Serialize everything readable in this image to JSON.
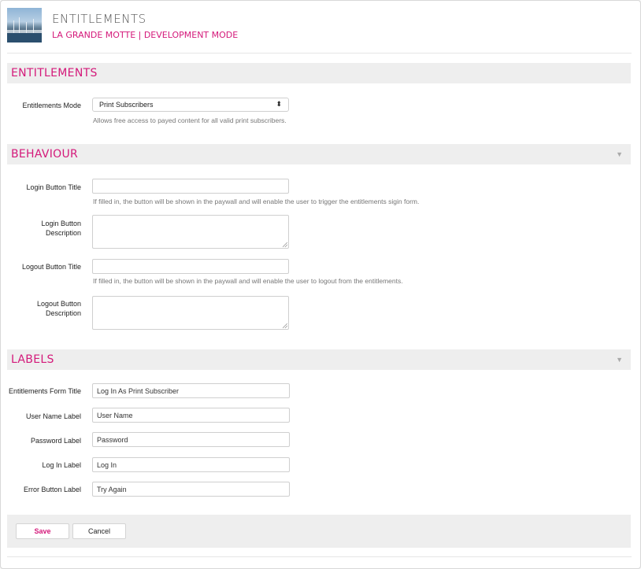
{
  "header": {
    "title": "ENTITLEMENTS",
    "subtitle": "LA GRANDE MOTTE | DEVELOPMENT MODE"
  },
  "sections": {
    "entitlements": {
      "title": "ENTITLEMENTS",
      "mode_label": "Entitlements Mode",
      "mode_value": "Print Subscribers",
      "mode_help": "Allows free access to payed content for all valid print subscribers."
    },
    "behaviour": {
      "title": "BEHAVIOUR",
      "toggle": "▼",
      "login_title_label": "Login Button Title",
      "login_title_value": "",
      "login_title_help": "If filled in, the button will be shown in the paywall and will enable the user to trigger the entitlements sigin form.",
      "login_desc_label_1": "Login Button",
      "login_desc_label_2": "Description",
      "logout_title_label": "Logout Button Title",
      "logout_title_value": "",
      "logout_title_help": "If filled in, the button will be shown in the paywall and will enable the user to logout from the entitlements.",
      "logout_desc_label_1": "Logout Button",
      "logout_desc_label_2": "Description"
    },
    "labels": {
      "title": "LABELS",
      "toggle": "▼",
      "fields": [
        {
          "label": "Entitlements Form Title",
          "value": "Log In As Print Subscriber"
        },
        {
          "label": "User Name Label",
          "value": "User Name"
        },
        {
          "label": "Password Label",
          "value": "Password"
        },
        {
          "label": "Log In Label",
          "value": "Log In"
        },
        {
          "label": "Error Button Label",
          "value": "Try Again"
        }
      ]
    }
  },
  "footer": {
    "save_label": "Save",
    "cancel_label": "Cancel"
  },
  "colors": {
    "accent": "#d4197a",
    "section_bg": "#eeeeee"
  }
}
